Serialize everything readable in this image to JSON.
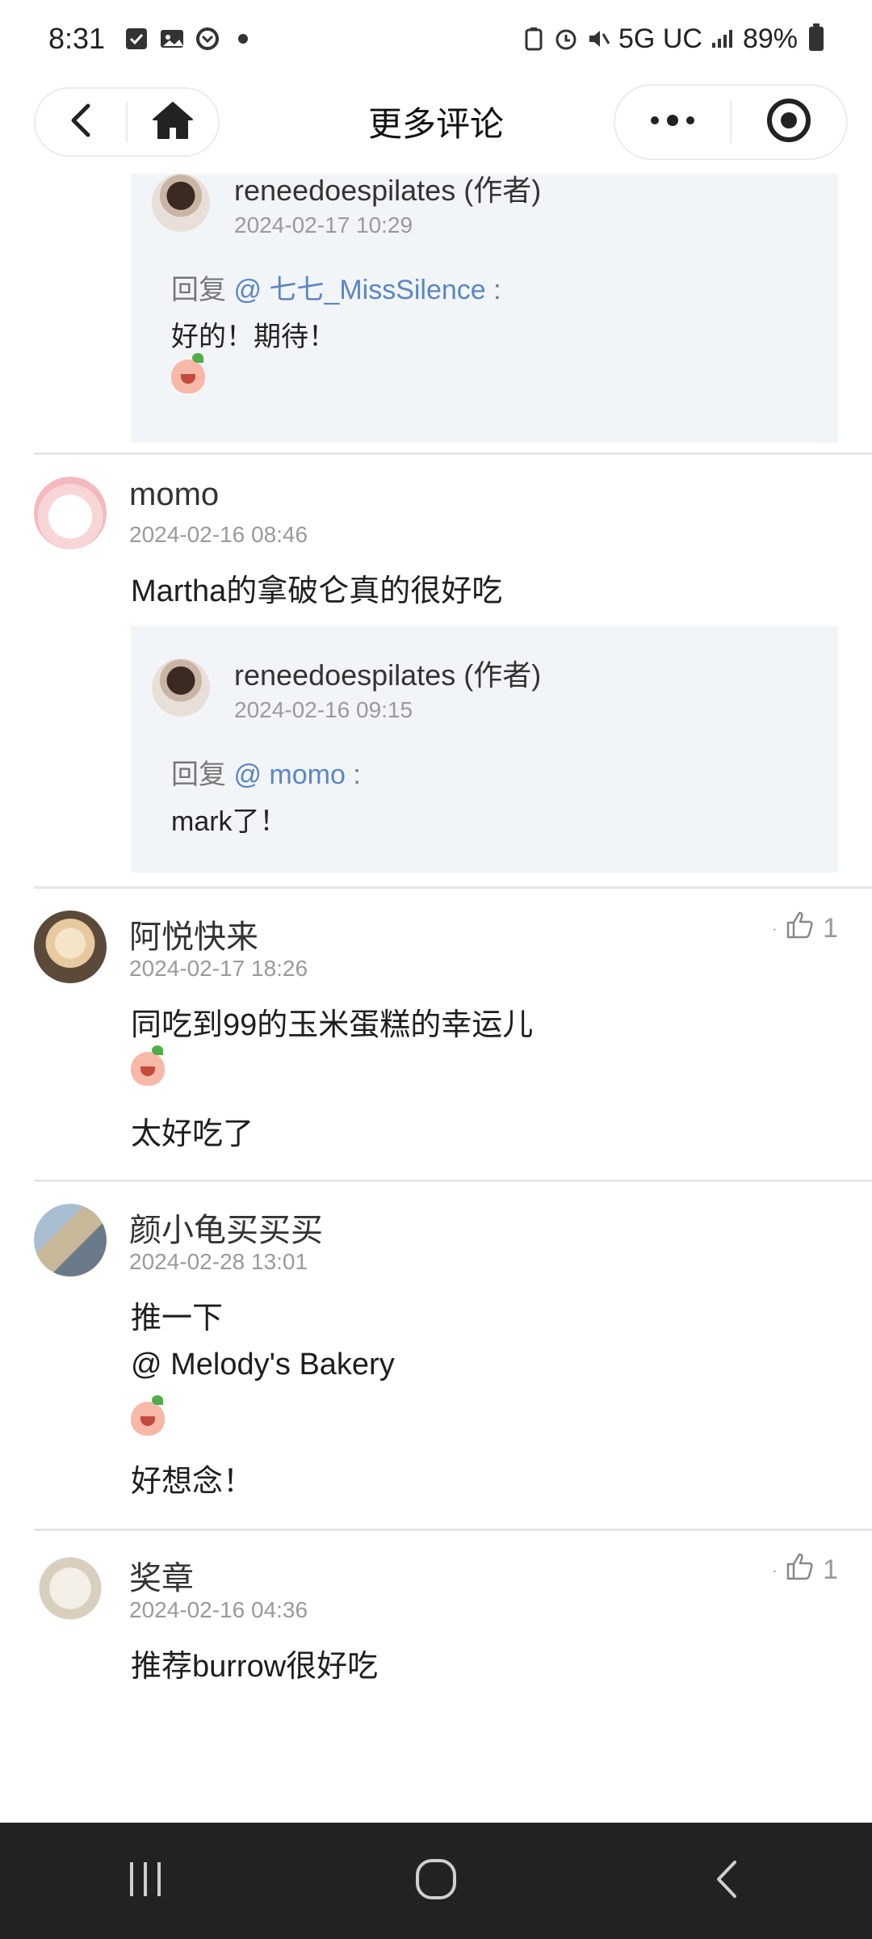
{
  "status_bar": {
    "time": "8:31",
    "network": "5G UC",
    "battery": "89%"
  },
  "header": {
    "title": "更多评论"
  },
  "thread": [
    {
      "reply": {
        "author": "reneedoespilates (作者)",
        "time": "2024-02-17 10:29",
        "prefix": "回复",
        "mention": "@ 七七_MissSilence",
        "colon": ":",
        "text": "好的！期待！"
      }
    },
    {
      "author": "momo",
      "time": "2024-02-16 08:46",
      "text": "Martha的拿破仑真的很好吃",
      "reply": {
        "author": "reneedoespilates (作者)",
        "time": "2024-02-16 09:15",
        "prefix": "回复",
        "mention": "@ momo",
        "colon": ":",
        "text": "mark了！"
      }
    },
    {
      "author": "阿悦快来",
      "time": "2024-02-17 18:26",
      "text1": "同吃到99的玉米蛋糕的幸运儿",
      "text2": "太好吃了",
      "likes": "1"
    },
    {
      "author": "颜小龟买买买",
      "time": "2024-02-28 13:01",
      "text1": "推一下",
      "mention": "@ Melody's Bakery",
      "text2": "好想念！"
    },
    {
      "author": "奖章",
      "time": "2024-02-16 04:36",
      "text": "推荐burrow很好吃",
      "likes": "1"
    }
  ],
  "colors": {
    "mention": "#5b86c2",
    "reply_bg": "#f2f5f8",
    "nav_bar": "#222222"
  }
}
